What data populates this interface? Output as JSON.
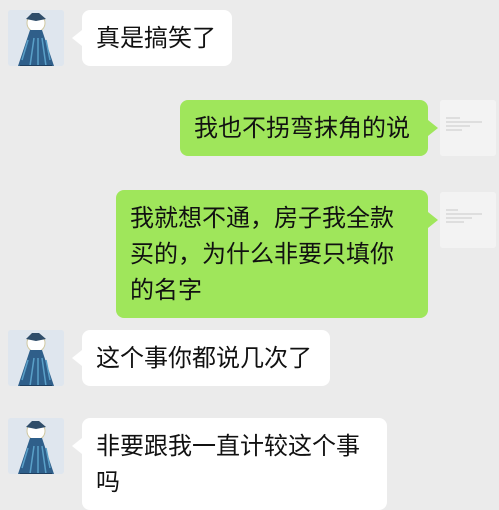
{
  "colors": {
    "background": "#ebebeb",
    "incoming_bubble": "#ffffff",
    "outgoing_bubble": "#9fe65b",
    "text": "#111111"
  },
  "messages": [
    {
      "id": "m1",
      "side": "left",
      "avatar": "cartoon-avatar",
      "text": "真是搞笑了"
    },
    {
      "id": "m2",
      "side": "right",
      "avatar": "blank-avatar",
      "text": "我也不拐弯抹角的说"
    },
    {
      "id": "m3",
      "side": "right",
      "avatar": "blank-avatar",
      "text": "我就想不通，房子我全款买的，为什么非要只填你的名字"
    },
    {
      "id": "m4",
      "side": "left",
      "avatar": "cartoon-avatar",
      "text": "这个事你都说几次了"
    },
    {
      "id": "m5",
      "side": "left",
      "avatar": "cartoon-avatar",
      "text": "非要跟我一直计较这个事吗"
    }
  ]
}
